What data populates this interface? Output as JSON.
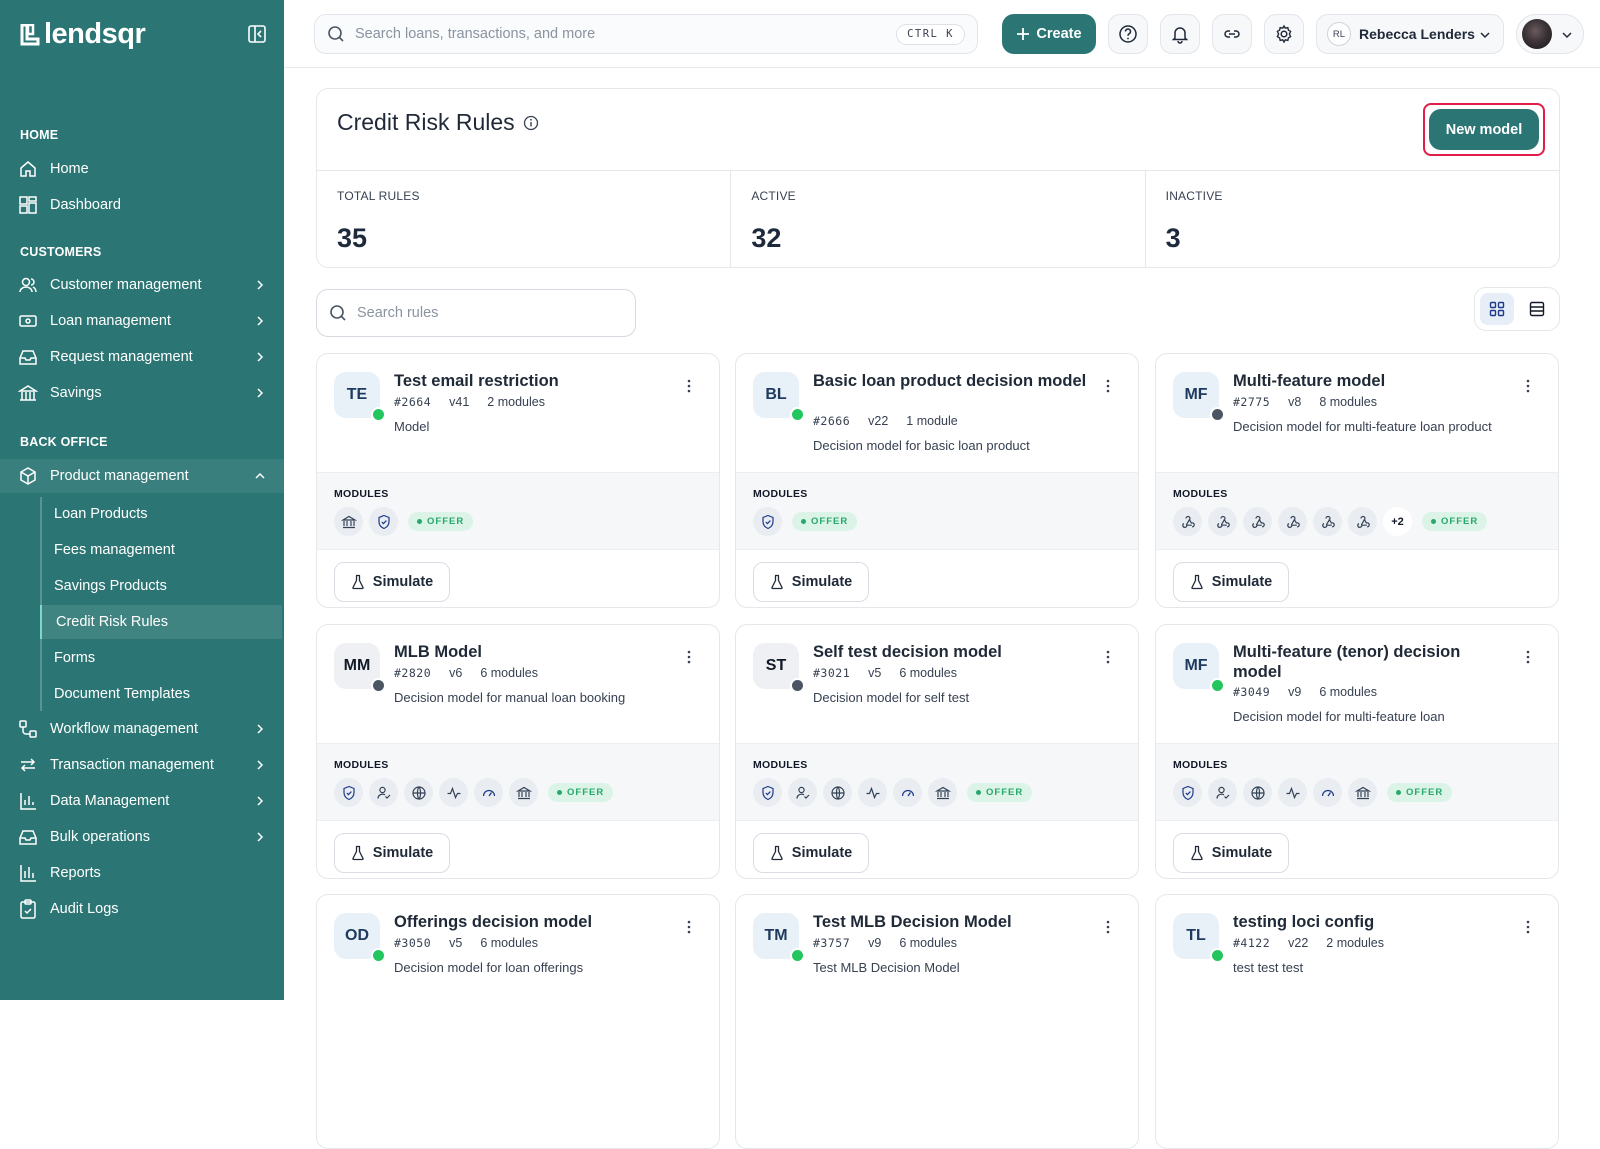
{
  "brand": {
    "name": "lendsqr"
  },
  "sidebar": {
    "sections": [
      {
        "heading": "HOME",
        "items": [
          {
            "label": "Home"
          },
          {
            "label": "Dashboard"
          }
        ]
      },
      {
        "heading": "CUSTOMERS",
        "items": [
          {
            "label": "Customer management"
          },
          {
            "label": "Loan management"
          },
          {
            "label": "Request management"
          },
          {
            "label": "Savings"
          }
        ]
      },
      {
        "heading": "BACK OFFICE",
        "items": [
          {
            "label": "Product management"
          },
          {
            "label": "Workflow management"
          },
          {
            "label": "Transaction management"
          },
          {
            "label": "Data Management"
          },
          {
            "label": "Bulk operations"
          },
          {
            "label": "Reports"
          },
          {
            "label": "Audit Logs"
          }
        ]
      }
    ],
    "product_sub": [
      "Loan Products",
      "Fees management",
      "Savings Products",
      "Credit Risk Rules",
      "Forms",
      "Document Templates"
    ],
    "active": "Credit Risk Rules"
  },
  "topbar": {
    "search_placeholder": "Search loans, transactions, and more",
    "shortcut": "CTRL K",
    "create_label": "Create",
    "user_initials": "RL",
    "user_name": "Rebecca Lenders"
  },
  "page": {
    "title": "Credit Risk Rules",
    "new_model_label": "New model",
    "stats": [
      {
        "label": "TOTAL RULES",
        "value": "35"
      },
      {
        "label": "ACTIVE",
        "value": "32"
      },
      {
        "label": "INACTIVE",
        "value": "3"
      }
    ],
    "search_placeholder": "Search rules",
    "modules_label": "MODULES",
    "offer_label": "OFFER",
    "simulate_label": "Simulate"
  },
  "cards": [
    {
      "initials": "TE",
      "title": "Test email restriction",
      "id": "#2664",
      "version": "v41",
      "modules": "2 modules",
      "desc": "Model",
      "status": "active",
      "icons": [
        "bank-icon",
        "shield-icon"
      ],
      "more": ""
    },
    {
      "initials": "BL",
      "title": "Basic loan product decision model",
      "id": "#2666",
      "version": "v22",
      "modules": "1 module",
      "desc": "Decision model for basic loan product",
      "status": "active",
      "icons": [
        "shield-icon"
      ],
      "more": ""
    },
    {
      "initials": "MF",
      "title": "Multi-feature model",
      "id": "#2775",
      "version": "v8",
      "modules": "8 modules",
      "desc": "Decision model for multi-feature loan product",
      "status": "inactive",
      "icons": [
        "webhook-icon",
        "webhook-icon",
        "webhook-icon",
        "webhook-icon",
        "webhook-icon",
        "webhook-icon"
      ],
      "more": "+2"
    },
    {
      "initials": "MM",
      "title": "MLB Model",
      "id": "#2820",
      "version": "v6",
      "modules": "6 modules",
      "desc": "Decision model for manual loan booking",
      "status": "inactive",
      "icons": [
        "shield-icon",
        "user-check-icon",
        "globe-icon",
        "pulse-icon",
        "gauge-icon",
        "bank-icon"
      ],
      "more": ""
    },
    {
      "initials": "ST",
      "title": "Self test decision model",
      "id": "#3021",
      "version": "v5",
      "modules": "6 modules",
      "desc": "Decision model for self test",
      "status": "inactive",
      "icons": [
        "shield-icon",
        "user-check-icon",
        "globe-icon",
        "pulse-icon",
        "gauge-icon",
        "bank-icon"
      ],
      "more": ""
    },
    {
      "initials": "MF",
      "title": "Multi-feature (tenor) decision model",
      "id": "#3049",
      "version": "v9",
      "modules": "6 modules",
      "desc": "Decision model for multi-feature loan",
      "status": "active",
      "icons": [
        "shield-icon",
        "user-check-icon",
        "globe-icon",
        "pulse-icon",
        "gauge-icon",
        "bank-icon"
      ],
      "more": ""
    },
    {
      "initials": "OD",
      "title": "Offerings decision model",
      "id": "#3050",
      "version": "v5",
      "modules": "6 modules",
      "desc": "Decision model for loan offerings",
      "status": "active",
      "icons": [],
      "more": ""
    },
    {
      "initials": "TM",
      "title": "Test MLB Decision Model",
      "id": "#3757",
      "version": "v9",
      "modules": "6 modules",
      "desc": "Test MLB Decision Model",
      "status": "active",
      "icons": [],
      "more": ""
    },
    {
      "initials": "TL",
      "title": "testing loci config",
      "id": "#4122",
      "version": "v22",
      "modules": "2 modules",
      "desc": "test test test",
      "status": "active",
      "icons": [],
      "more": ""
    }
  ],
  "colors": {
    "brand": "#2b7674",
    "active_dot": "#22c55e",
    "inactive_dot": "#4b5563",
    "highlight": "#e11d48"
  }
}
